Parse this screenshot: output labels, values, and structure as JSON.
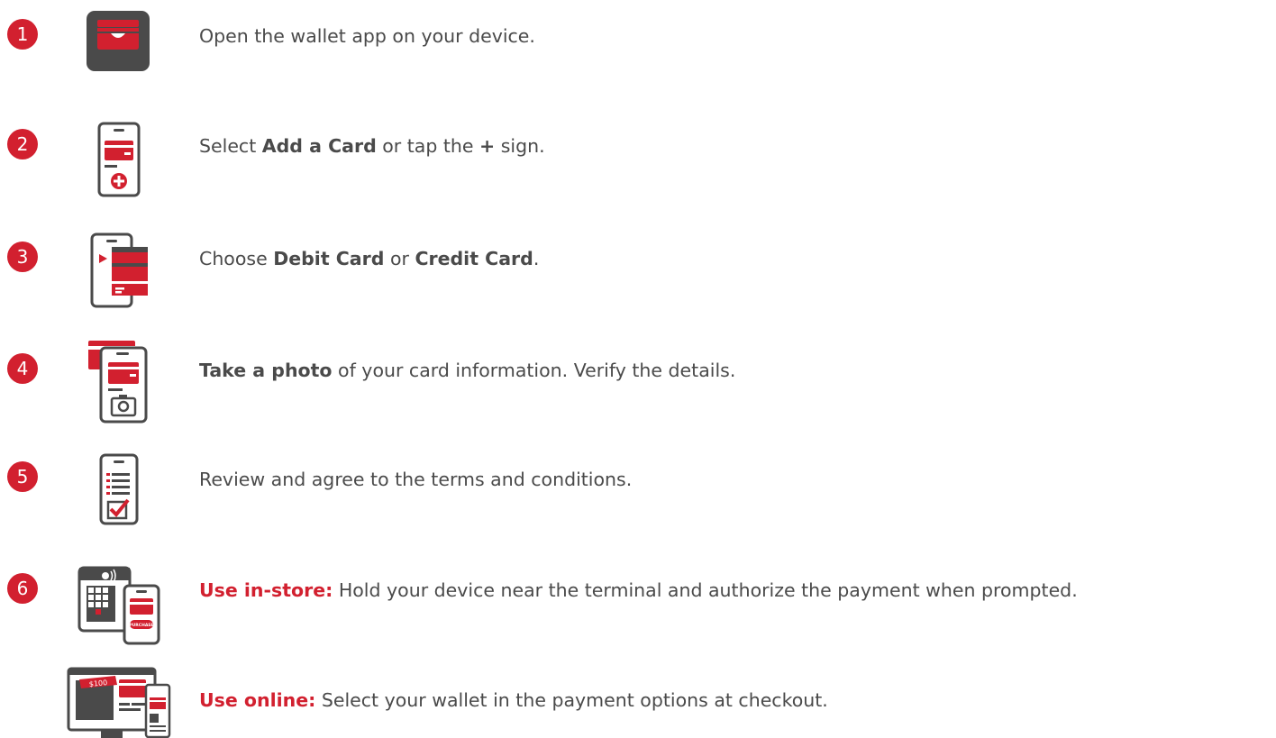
{
  "steps": [
    {
      "number": "1",
      "parts": [
        "Open the wallet app on your device."
      ],
      "icon": "wallet-app-icon"
    },
    {
      "number": "2",
      "parts": [
        "Select ",
        "Add a Card",
        " or tap the ",
        "+",
        " sign."
      ],
      "icon": "phone-add-card-icon"
    },
    {
      "number": "3",
      "parts": [
        "Choose ",
        "Debit Card",
        " or ",
        "Credit Card",
        "."
      ],
      "icon": "phone-choose-card-icon"
    },
    {
      "number": "4",
      "parts": [
        "Take a photo",
        " of your card information. Verify the details."
      ],
      "icon": "phone-camera-card-icon"
    },
    {
      "number": "5",
      "parts": [
        "Review and agree to the terms and conditions."
      ],
      "icon": "phone-terms-checklist-icon"
    },
    {
      "number": "6",
      "parts": [
        "Use in-store:",
        " Hold your device near the terminal and authorize the payment when prompted."
      ],
      "icon": "terminal-payment-icon"
    }
  ],
  "online": {
    "parts": [
      "Use online:",
      " Select your wallet in the payment options at checkout."
    ],
    "icon": "online-checkout-icon"
  },
  "icon_text": {
    "purchase": "PURCHASE",
    "price": "$100"
  },
  "colors": {
    "accent": "#d2202f",
    "dark": "#4a4a4a",
    "text": "#4a4a4a"
  }
}
